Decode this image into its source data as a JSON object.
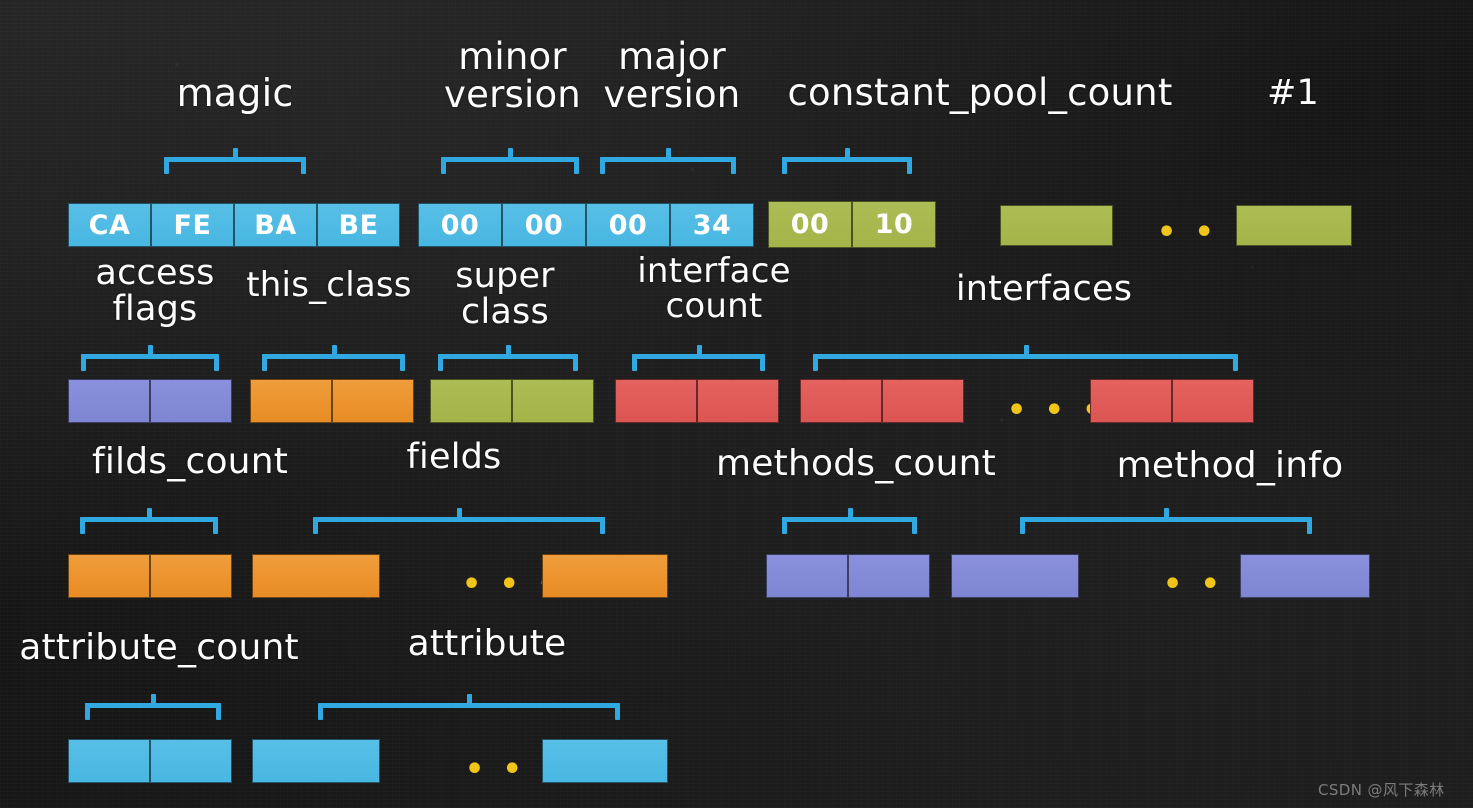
{
  "diagram": {
    "title": "Java class file structure byte layout",
    "colors": {
      "blue": "#48b7e2",
      "olive": "#a4b449",
      "purple": "#7e85d2",
      "orange": "#e88c24",
      "red": "#db5553",
      "bracket": "#31a8e0",
      "ellipsis": "#f0c419",
      "background": "#161616",
      "label_text": "#fdfdfd"
    },
    "ellipsis_glyph": "• • •",
    "rows": [
      {
        "name": "row-1-header",
        "labels": [
          {
            "id": "magic",
            "text": "magic"
          },
          {
            "id": "minor-version",
            "text": "minor\nversion"
          },
          {
            "id": "major-version",
            "text": "major\nversion"
          },
          {
            "id": "constant-pool-count",
            "text": "constant_pool_count"
          },
          {
            "id": "constant-pool-entry-1",
            "text": "#1"
          }
        ],
        "groups": [
          {
            "id": "magic-bytes",
            "color": "blue",
            "cells": [
              "CA",
              "FE",
              "BA",
              "BE"
            ]
          },
          {
            "id": "version-bytes",
            "color": "blue",
            "cells": [
              "00",
              "00",
              "00",
              "34"
            ]
          },
          {
            "id": "constant-pool-count-bytes",
            "color": "olive",
            "cells": [
              "00",
              "10"
            ]
          },
          {
            "id": "constant-pool-entry-first",
            "color": "olive",
            "cells": [
              ""
            ]
          },
          {
            "id": "constant-pool-entry-last",
            "color": "olive",
            "cells": [
              ""
            ]
          }
        ]
      },
      {
        "name": "row-2-class-info",
        "labels": [
          {
            "id": "access-flags",
            "text": "access\nflags"
          },
          {
            "id": "this-class",
            "text": "this_class"
          },
          {
            "id": "super-class",
            "text": "super\nclass"
          },
          {
            "id": "interface-count",
            "text": "interface\ncount"
          },
          {
            "id": "interfaces",
            "text": "interfaces"
          }
        ],
        "groups": [
          {
            "id": "access-flags-bytes",
            "color": "purple",
            "cells": [
              "",
              ""
            ]
          },
          {
            "id": "this-class-bytes",
            "color": "orange",
            "cells": [
              "",
              ""
            ]
          },
          {
            "id": "super-class-bytes",
            "color": "olive",
            "cells": [
              "",
              ""
            ]
          },
          {
            "id": "interface-count-bytes",
            "color": "red",
            "cells": [
              "",
              ""
            ]
          },
          {
            "id": "interface-entry-first",
            "color": "red",
            "cells": [
              "",
              ""
            ]
          },
          {
            "id": "interface-entry-last",
            "color": "red",
            "cells": [
              "",
              ""
            ]
          }
        ]
      },
      {
        "name": "row-3-fields-methods",
        "labels": [
          {
            "id": "filds-count",
            "text": "filds_count"
          },
          {
            "id": "fields",
            "text": "fields"
          },
          {
            "id": "methods-count",
            "text": "methods_count"
          },
          {
            "id": "method-info",
            "text": "method_info"
          }
        ],
        "groups": [
          {
            "id": "fields-count-bytes",
            "color": "orange",
            "cells": [
              "",
              ""
            ]
          },
          {
            "id": "field-entry-first",
            "color": "orange",
            "cells": [
              ""
            ]
          },
          {
            "id": "field-entry-last",
            "color": "orange",
            "cells": [
              ""
            ]
          },
          {
            "id": "methods-count-bytes",
            "color": "purple",
            "cells": [
              "",
              ""
            ]
          },
          {
            "id": "method-entry-first",
            "color": "purple",
            "cells": [
              ""
            ]
          },
          {
            "id": "method-entry-last",
            "color": "purple",
            "cells": [
              ""
            ]
          }
        ]
      },
      {
        "name": "row-4-attributes",
        "labels": [
          {
            "id": "attribute-count",
            "text": "attribute_count"
          },
          {
            "id": "attribute",
            "text": "attribute"
          }
        ],
        "groups": [
          {
            "id": "attribute-count-bytes",
            "color": "blue",
            "cells": [
              "",
              ""
            ]
          },
          {
            "id": "attribute-entry-first",
            "color": "blue",
            "cells": [
              ""
            ]
          },
          {
            "id": "attribute-entry-last",
            "color": "blue",
            "cells": [
              ""
            ]
          }
        ]
      }
    ]
  },
  "watermark": {
    "text": "CSDN @风下森林"
  }
}
